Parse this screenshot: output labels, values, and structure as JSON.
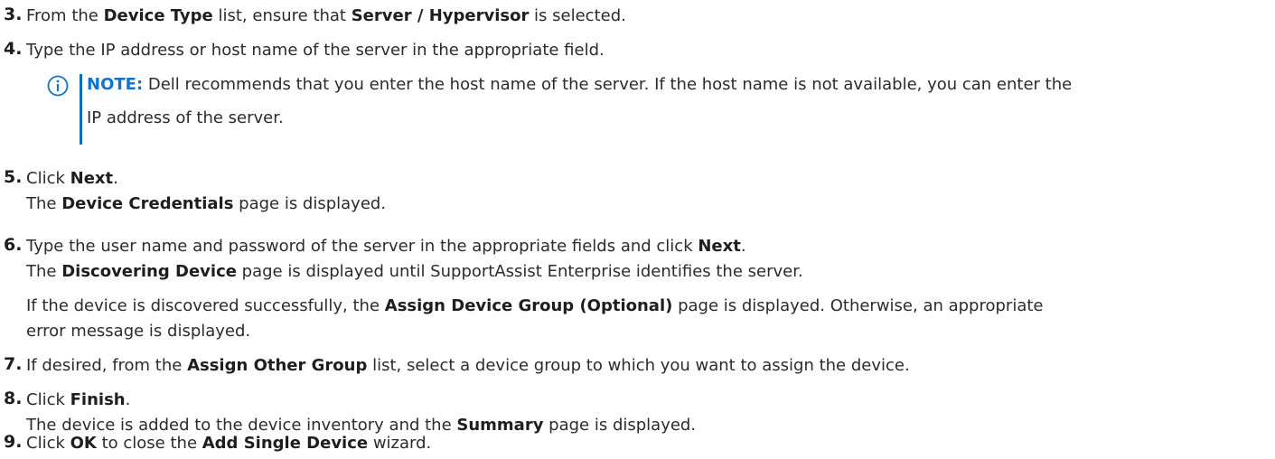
{
  "steps": [
    {
      "num": "3.",
      "lines": [
        [
          "From the ",
          {
            "b": "Device Type"
          },
          " list, ensure that ",
          {
            "b": "Server / Hypervisor"
          },
          " is selected."
        ]
      ]
    },
    {
      "num": "4.",
      "lines": [
        [
          "Type the IP address or host name of the server in the appropriate field."
        ]
      ]
    },
    {
      "num": "5.",
      "lines": [
        [
          "Click ",
          {
            "b": "Next"
          },
          "."
        ],
        [
          "The ",
          {
            "b": "Device Credentials"
          },
          " page is displayed."
        ]
      ]
    },
    {
      "num": "6.",
      "lines": [
        [
          "Type the user name and password of the server in the appropriate fields and click ",
          {
            "b": "Next"
          },
          "."
        ],
        [
          "The ",
          {
            "b": "Discovering Device"
          },
          " page is displayed until SupportAssist Enterprise identifies the server."
        ]
      ]
    },
    {
      "num": "",
      "lines": [
        [
          "If the device is discovered successfully, the ",
          {
            "b": "Assign Device Group (Optional)"
          },
          " page is displayed. Otherwise, an appropriate"
        ],
        [
          "error message is displayed."
        ]
      ]
    },
    {
      "num": "7.",
      "lines": [
        [
          "If desired, from the ",
          {
            "b": "Assign Other Group"
          },
          " list, select a device group to which you want to assign the device."
        ]
      ]
    },
    {
      "num": "8.",
      "lines": [
        [
          "Click ",
          {
            "b": "Finish"
          },
          "."
        ],
        [
          "The device is added to the device inventory and the ",
          {
            "b": "Summary"
          },
          " page is displayed."
        ]
      ]
    },
    {
      "num": "9.",
      "lines": [
        [
          "Click ",
          {
            "b": "OK"
          },
          " to close the ",
          {
            "b": "Add Single Device"
          },
          " wizard."
        ]
      ]
    }
  ],
  "note": {
    "label": "NOTE:",
    "line1": "Dell recommends that you enter the host name of the server. If the host name is not available, you can enter the",
    "line2": "IP address of the server."
  },
  "colors": {
    "note_accent": "#1273c9",
    "text": "#2b2b2b"
  }
}
